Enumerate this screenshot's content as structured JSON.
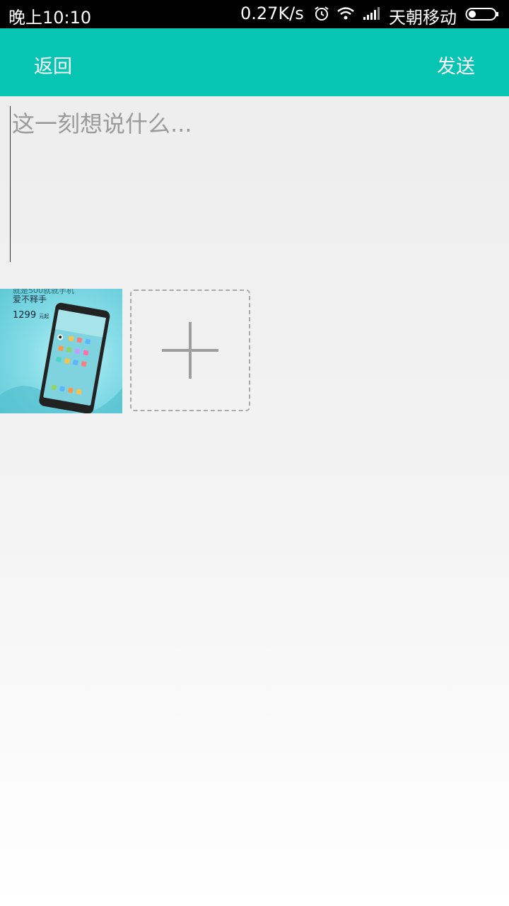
{
  "status_bar": {
    "time": "晚上10:10",
    "net_speed": "0.27K/s",
    "carrier": "天朝移动",
    "icons": [
      "alarm-icon",
      "wifi-icon",
      "signal-icon",
      "battery-icon"
    ]
  },
  "toolbar": {
    "back_label": "返回",
    "send_label": "发送",
    "color": "#06c5b2"
  },
  "compose": {
    "placeholder": "这一刻想说什么...",
    "value": ""
  },
  "attachments": {
    "images": [
      {
        "caption_line1": "就是500就就手机",
        "caption_line2": "爱不释手",
        "price": "1299",
        "price_unit": "元起"
      }
    ],
    "add_icon": "plus-icon"
  }
}
